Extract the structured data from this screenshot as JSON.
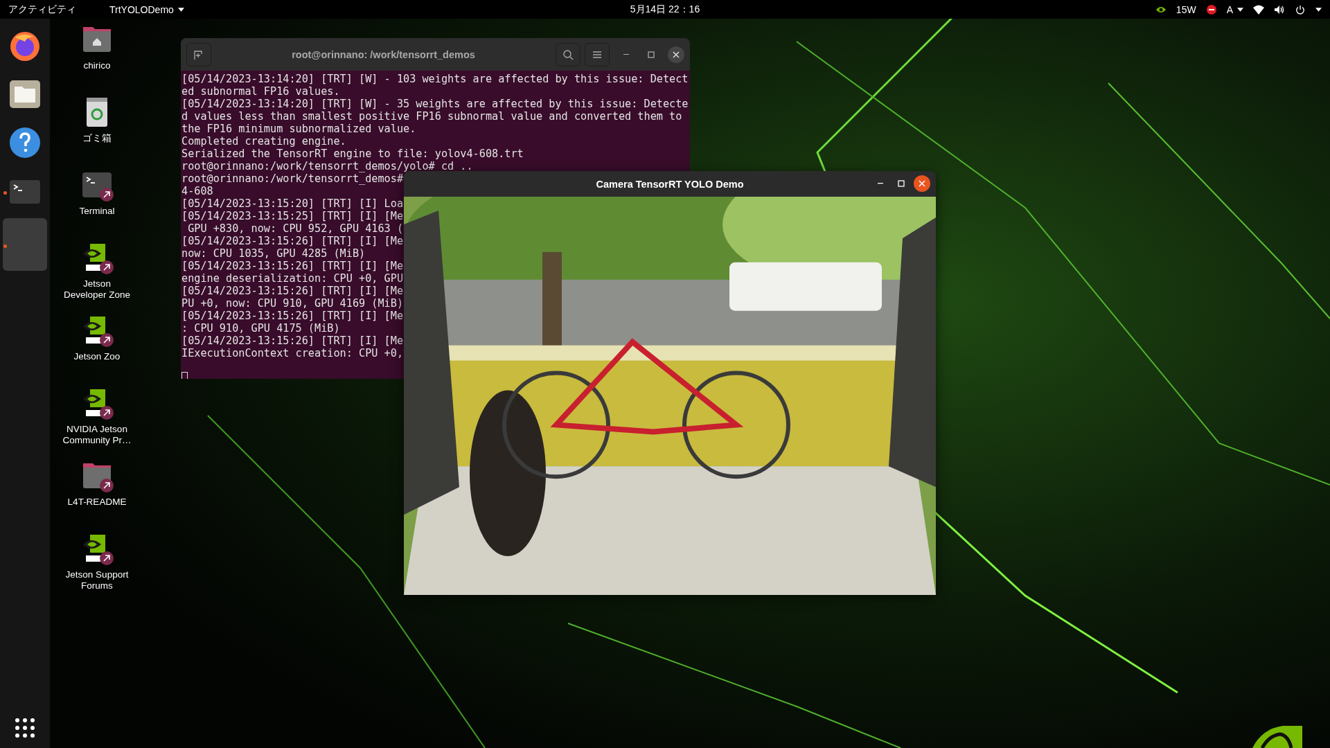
{
  "top_bar": {
    "activities": "アクティビティ",
    "app_menu": "TrtYOLODemo",
    "clock": "5月14日  22：16",
    "power": "15W",
    "input_method": "A"
  },
  "dock": {
    "items": [
      {
        "kind": "firefox",
        "running": false,
        "selected": false
      },
      {
        "kind": "files",
        "running": false,
        "selected": false
      },
      {
        "kind": "help",
        "running": false,
        "selected": false
      },
      {
        "kind": "terminal",
        "running": true,
        "selected": false
      },
      {
        "kind": "blank",
        "running": true,
        "selected": true
      }
    ]
  },
  "desktop_icons": [
    {
      "kind": "home",
      "label": "chirico",
      "shortcut": false
    },
    {
      "kind": "trash",
      "label": "ゴミ箱",
      "shortcut": false
    },
    {
      "kind": "terminal",
      "label": "Terminal",
      "shortcut": true
    },
    {
      "kind": "nvidia",
      "label": "Jetson Developer Zone",
      "shortcut": true
    },
    {
      "kind": "nvidia",
      "label": "Jetson Zoo",
      "shortcut": true
    },
    {
      "kind": "nvidia",
      "label": "NVIDIA Jetson Community Pr…",
      "shortcut": true
    },
    {
      "kind": "folder",
      "label": "L4T-README",
      "shortcut": true
    },
    {
      "kind": "nvidia",
      "label": "Jetson Support Forums",
      "shortcut": true
    }
  ],
  "terminal": {
    "title": "root@orinnano: /work/tensorrt_demos",
    "cursor": true,
    "lines": [
      "[05/14/2023-13:14:20] [TRT] [W] - 103 weights are affected by this issue: Detect",
      "ed subnormal FP16 values.",
      "[05/14/2023-13:14:20] [TRT] [W] - 35 weights are affected by this issue: Detecte",
      "d values less than smallest positive FP16 subnormal value and converted them to",
      "the FP16 minimum subnormalized value.",
      "Completed creating engine.",
      "Serialized the TensorRT engine to file: yolov4-608.trt",
      "root@orinnano:/work/tensorrt_demos/yolo# cd ..",
      "root@orinnano:/work/tensorrt_demos#",
      "4-608",
      "[05/14/2023-13:15:20] [TRT] [I] Loa",
      "[05/14/2023-13:15:25] [TRT] [I] [Me",
      " GPU +830, now: CPU 952, GPU 4163 (",
      "[05/14/2023-13:15:26] [TRT] [I] [Me",
      "now: CPU 1035, GPU 4285 (MiB)",
      "[05/14/2023-13:15:26] [TRT] [I] [Me",
      "engine deserialization: CPU +0, GPU",
      "[05/14/2023-13:15:26] [TRT] [I] [Me",
      "PU +0, now: CPU 910, GPU 4169 (MiB)",
      "[05/14/2023-13:15:26] [TRT] [I] [Me",
      ": CPU 910, GPU 4175 (MiB)",
      "[05/14/2023-13:15:26] [TRT] [I] [Me",
      "IExecutionContext creation: CPU +0,"
    ]
  },
  "camera_window": {
    "title": "Camera TensorRT YOLO Demo"
  }
}
